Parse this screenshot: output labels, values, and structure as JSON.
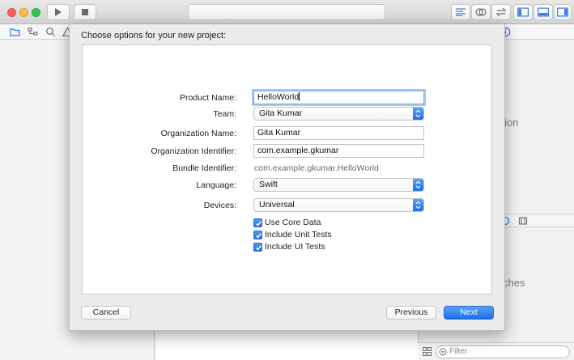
{
  "sheet": {
    "title": "Choose options for your new project:",
    "fields": {
      "product_name": {
        "label": "Product Name:",
        "value": "HelloWorld"
      },
      "team": {
        "label": "Team:",
        "value": "Gita Kumar"
      },
      "organization_name": {
        "label": "Organization Name:",
        "value": "Gita Kumar"
      },
      "organization_identifier": {
        "label": "Organization Identifier:",
        "value": "com.example.gkumar"
      },
      "bundle_identifier": {
        "label": "Bundle Identifier:",
        "value": "com.example.gkumar.HelloWorld"
      },
      "language": {
        "label": "Language:",
        "value": "Swift"
      },
      "devices": {
        "label": "Devices:",
        "value": "Universal"
      }
    },
    "options": [
      {
        "label": "Use Core Data",
        "checked": true
      },
      {
        "label": "Include Unit Tests",
        "checked": true
      },
      {
        "label": "Include UI Tests",
        "checked": true
      }
    ],
    "buttons": {
      "cancel": "Cancel",
      "previous": "Previous",
      "next": "Next"
    }
  },
  "background": {
    "right_text_top": "ction",
    "right_text_bottom": "ches",
    "filter_placeholder": "Filter"
  },
  "colors": {
    "accent": "#1c6fe8",
    "focus_ring": "#a9c7f2"
  }
}
